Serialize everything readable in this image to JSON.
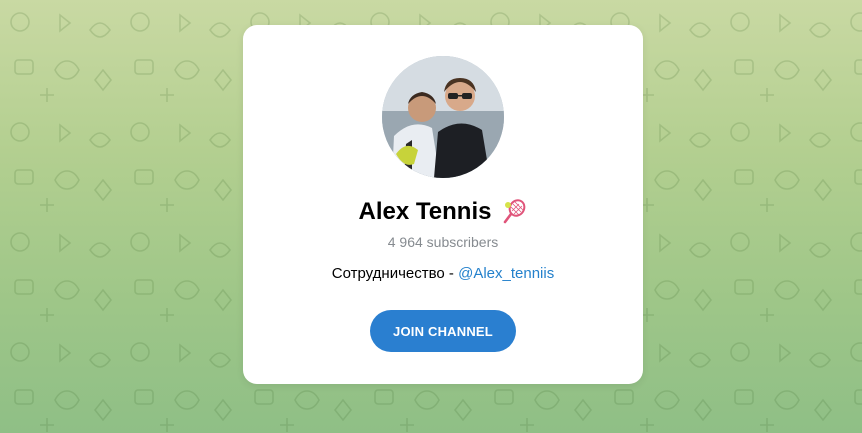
{
  "channel": {
    "title": "Alex Tennis",
    "title_emoji": "tennis-racket-icon",
    "subscribers": "4 964 subscribers",
    "description_prefix": "Сотрудничество - ",
    "description_link": "@Alex_tenniis",
    "join_label": "JOIN CHANNEL"
  },
  "colors": {
    "accent": "#2a7fd0",
    "link": "#2481cc",
    "muted": "#868b90",
    "background_top": "#c9d9a3",
    "background_bottom": "#8fbf86"
  }
}
